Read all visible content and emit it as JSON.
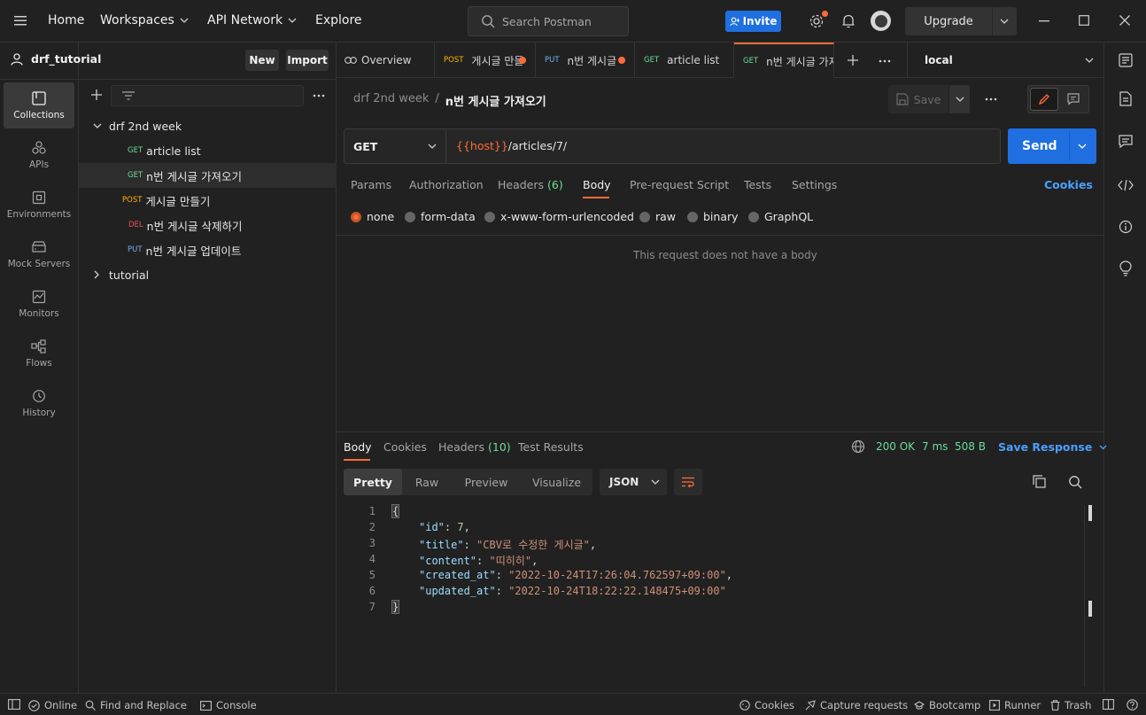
{
  "topbar": {
    "nav": {
      "home": "Home",
      "workspaces": "Workspaces",
      "api_network": "API Network",
      "explore": "Explore"
    },
    "search_placeholder": "Search Postman",
    "invite_label": "Invite",
    "upgrade_label": "Upgrade"
  },
  "rail": {
    "items": [
      {
        "label": "Collections",
        "icon": "collections-icon"
      },
      {
        "label": "APIs",
        "icon": "apis-icon"
      },
      {
        "label": "Environments",
        "icon": "environments-icon"
      },
      {
        "label": "Mock Servers",
        "icon": "mock-servers-icon"
      },
      {
        "label": "Monitors",
        "icon": "monitors-icon"
      },
      {
        "label": "Flows",
        "icon": "flows-icon"
      },
      {
        "label": "History",
        "icon": "history-icon"
      }
    ]
  },
  "sidebar": {
    "workspace_name": "drf_tutorial",
    "new_label": "New",
    "import_label": "Import",
    "tree": {
      "collection1": "drf 2nd week",
      "requests": [
        {
          "method": "GET",
          "name": "article list"
        },
        {
          "method": "GET",
          "name": "n번 게시글 가져오기"
        },
        {
          "method": "POST",
          "name": "게시글 만들기"
        },
        {
          "method": "DEL",
          "name": "n번 게시글 삭제하기"
        },
        {
          "method": "PUT",
          "name": "n번 게시글 업데이트"
        }
      ],
      "collection2": "tutorial"
    }
  },
  "tabs": {
    "overview": "Overview",
    "items": [
      {
        "method": "POST",
        "name": "게시글 만들"
      },
      {
        "method": "PUT",
        "name": "n번 게시글"
      },
      {
        "method": "GET",
        "name": "article list"
      },
      {
        "method": "GET",
        "name": "n번 게시글 가져"
      }
    ],
    "environment": "local"
  },
  "request": {
    "breadcrumb_parent": "drf 2nd week",
    "breadcrumb_sep": "/",
    "breadcrumb_current": "n번 게시글 가져오기",
    "save_label": "Save",
    "method": "GET",
    "url_var": "{{host}}",
    "url_path": "/articles/7/",
    "send_label": "Send",
    "tabs": {
      "params": "Params",
      "authorization": "Authorization",
      "headers": "Headers",
      "headers_count": "(6)",
      "body": "Body",
      "prerequest": "Pre-request Script",
      "tests": "Tests",
      "settings": "Settings"
    },
    "cookies_label": "Cookies",
    "body_types": {
      "none": "none",
      "form_data": "form-data",
      "urlencoded": "x-www-form-urlencoded",
      "raw": "raw",
      "binary": "binary",
      "graphql": "GraphQL"
    },
    "no_body_text": "This request does not have a body"
  },
  "response": {
    "tabs": {
      "body": "Body",
      "cookies": "Cookies",
      "headers": "Headers",
      "headers_count": "(10)",
      "test_results": "Test Results"
    },
    "status": "200 OK",
    "time": "7 ms",
    "size": "508 B",
    "save_response": "Save Response",
    "views": {
      "pretty": "Pretty",
      "raw": "Raw",
      "preview": "Preview",
      "visualize": "Visualize"
    },
    "format": "JSON",
    "line_numbers": [
      "1",
      "2",
      "3",
      "4",
      "5",
      "6",
      "7"
    ],
    "json": {
      "open": "{",
      "id_key": "\"id\"",
      "id_val": "7",
      "title_key": "\"title\"",
      "title_val": "\"CBV로 수정한 게시글\"",
      "content_key": "\"content\"",
      "content_val": "\"띠히히\"",
      "created_key": "\"created_at\"",
      "created_val": "\"2022-10-24T17:26:04.762597+09:00\"",
      "updated_key": "\"updated_at\"",
      "updated_val": "\"2022-10-24T18:22:22.148475+09:00\"",
      "close": "}"
    }
  },
  "statusbar": {
    "online": "Online",
    "find_replace": "Find and Replace",
    "console": "Console",
    "cookies": "Cookies",
    "capture": "Capture requests",
    "bootcamp": "Bootcamp",
    "runner": "Runner",
    "trash": "Trash"
  },
  "colors": {
    "accent": "#ff6c37",
    "primary": "#1f6fe0",
    "status_ok": "#6bdd9a"
  }
}
